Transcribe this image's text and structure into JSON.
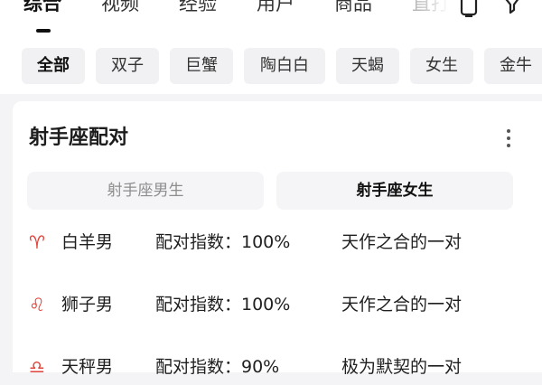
{
  "top_tabs": [
    {
      "label": "综合",
      "active": true
    },
    {
      "label": "视频",
      "active": false
    },
    {
      "label": "经验",
      "active": false
    },
    {
      "label": "用户",
      "active": false
    },
    {
      "label": "商品",
      "active": false
    },
    {
      "label": "直打",
      "active": false
    }
  ],
  "top_icons": [
    "clipboard-icon",
    "filter-icon"
  ],
  "chips": [
    {
      "label": "全部",
      "active": true
    },
    {
      "label": "双子",
      "active": false
    },
    {
      "label": "巨蟹",
      "active": false
    },
    {
      "label": "陶白白",
      "active": false
    },
    {
      "label": "天蝎",
      "active": false
    },
    {
      "label": "女生",
      "active": false
    },
    {
      "label": "金牛",
      "active": false
    }
  ],
  "card": {
    "title": "射手座配对",
    "segments": [
      {
        "label": "射手座男生",
        "selected": false
      },
      {
        "label": "射手座女生",
        "selected": true
      }
    ],
    "rows": [
      {
        "sign": "♈",
        "sign_icon": "aries-icon",
        "name": "白羊男",
        "score": "配对指数：100%",
        "desc": "天作之合的一对"
      },
      {
        "sign": "♌",
        "sign_icon": "leo-icon",
        "name": "狮子男",
        "score": "配对指数：100%",
        "desc": "天作之合的一对"
      },
      {
        "sign": "♎",
        "sign_icon": "libra-icon",
        "name": "天秤男",
        "score": "配对指数：90%",
        "desc": "极为默契的一对"
      }
    ]
  },
  "colors": {
    "accent_red": "#e0433a",
    "chip_bg": "#f1f1f3",
    "page_bg": "#f4f4f6"
  }
}
